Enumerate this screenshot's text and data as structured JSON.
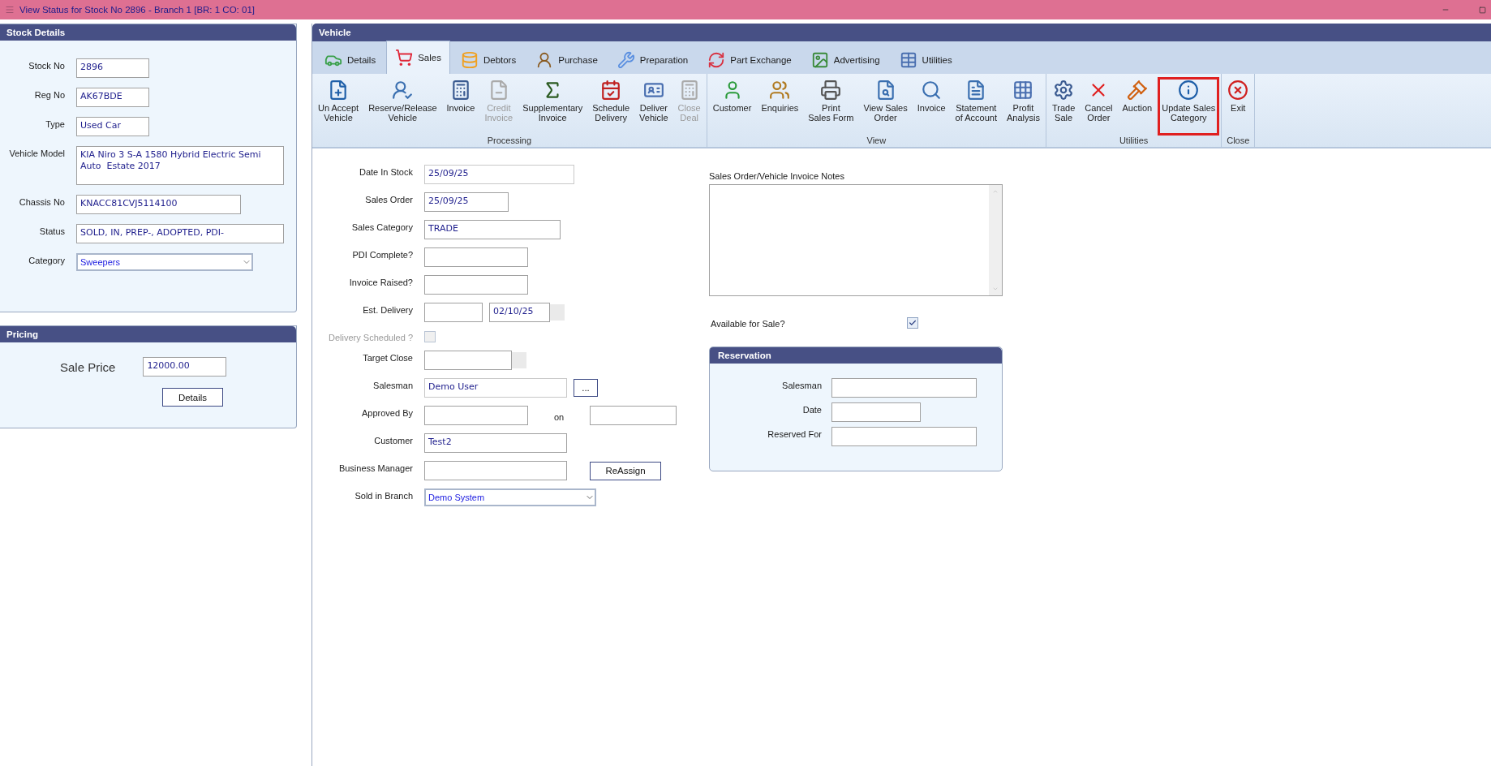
{
  "window": {
    "title": "View Status for Stock No 2896 - Branch 1 [BR: 1 CO: 01]"
  },
  "stock_details": {
    "title": "Stock Details",
    "fields": [
      {
        "kind": "text",
        "label": "Stock No",
        "value": "2896"
      },
      {
        "kind": "text",
        "label": "Reg No",
        "value": "AK67BDE"
      },
      {
        "kind": "text",
        "label": "Type",
        "value": "Used Car"
      },
      {
        "kind": "multiline",
        "label": "Vehicle Model",
        "value": "KIA Niro 3 S-A 1580 Hybrid Electric Semi Auto  Estate 2017"
      },
      {
        "kind": "text",
        "label": "Chassis No",
        "value": "KNACC81CVJ5114100"
      },
      {
        "kind": "text",
        "label": "Status",
        "value": "SOLD, IN, PREP-, ADOPTED, PDI-"
      },
      {
        "kind": "select",
        "label": "Category",
        "value": "Sweepers"
      }
    ]
  },
  "pricing": {
    "title": "Pricing",
    "label": "Sale Price",
    "value": "12000.00",
    "button": "Details"
  },
  "vehicle": {
    "title": "Vehicle",
    "tabs": [
      {
        "label": "Details",
        "selected": false
      },
      {
        "label": "Sales",
        "selected": true
      },
      {
        "label": "Debtors",
        "selected": false
      },
      {
        "label": "Purchase",
        "selected": false
      },
      {
        "label": "Preparation",
        "selected": false
      },
      {
        "label": "Part Exchange",
        "selected": false
      },
      {
        "label": "Advertising",
        "selected": false
      },
      {
        "label": "Utilities",
        "selected": false
      }
    ],
    "ribbon": [
      {
        "label": "Processing",
        "buttons": [
          {
            "label": "Un Accept\nVehicle",
            "disabled": false,
            "highlighted": false
          },
          {
            "label": "Reserve/Release\nVehicle",
            "disabled": false,
            "highlighted": false
          },
          {
            "label": "Invoice",
            "disabled": false,
            "highlighted": false
          },
          {
            "label": "Credit\nInvoice",
            "disabled": true,
            "highlighted": false
          },
          {
            "label": "Supplementary\nInvoice",
            "disabled": false,
            "highlighted": false
          },
          {
            "label": "Schedule\nDelivery",
            "disabled": false,
            "highlighted": false
          },
          {
            "label": "Deliver\nVehicle",
            "disabled": false,
            "highlighted": false
          },
          {
            "label": "Close\nDeal",
            "disabled": true,
            "highlighted": false
          }
        ]
      },
      {
        "label": "View",
        "buttons": [
          {
            "label": "Customer",
            "disabled": false,
            "highlighted": false
          },
          {
            "label": "Enquiries",
            "disabled": false,
            "highlighted": false
          },
          {
            "label": "Print\nSales Form",
            "disabled": false,
            "highlighted": false
          },
          {
            "label": "View Sales\nOrder",
            "disabled": false,
            "highlighted": false
          },
          {
            "label": "Invoice",
            "disabled": false,
            "highlighted": false
          },
          {
            "label": "Statement\nof Account",
            "disabled": false,
            "highlighted": false
          },
          {
            "label": "Profit\nAnalysis",
            "disabled": false,
            "highlighted": false
          }
        ]
      },
      {
        "label": "Utilities",
        "buttons": [
          {
            "label": "Trade\nSale",
            "disabled": false,
            "highlighted": false
          },
          {
            "label": "Cancel\nOrder",
            "disabled": false,
            "highlighted": false
          },
          {
            "label": "Auction",
            "disabled": false,
            "highlighted": false
          },
          {
            "label": "Update Sales\nCategory",
            "disabled": false,
            "highlighted": true
          }
        ]
      },
      {
        "label": "Close",
        "buttons": [
          {
            "label": "Exit",
            "disabled": false,
            "highlighted": false
          }
        ]
      }
    ]
  },
  "sales_form": [
    {
      "kind": "text",
      "label": "Date In Stock",
      "value": "25/09/25"
    },
    {
      "kind": "text",
      "label": "Sales Order",
      "value": "25/09/25"
    },
    {
      "kind": "text",
      "label": "Sales Category",
      "value": "TRADE"
    },
    {
      "kind": "text",
      "label": "PDI Complete?"
    },
    {
      "kind": "text",
      "label": "Invoice Raised?"
    },
    {
      "kind": "date_pair",
      "label": "Est. Delivery",
      "value_2": "02/10/25"
    },
    {
      "kind": "checkbox",
      "label": "Delivery Scheduled ?",
      "checked": false,
      "disabled": true
    },
    {
      "kind": "date",
      "label": "Target Close"
    },
    {
      "kind": "lookup",
      "label": "Salesman",
      "value": "Demo User",
      "button": "..."
    },
    {
      "kind": "approval",
      "label": "Approved By",
      "on_label": "on"
    },
    {
      "kind": "text",
      "label": "Customer",
      "value": "Test2"
    },
    {
      "kind": "action",
      "label": "Business Manager",
      "button": "ReAssign"
    },
    {
      "kind": "select",
      "label": "Sold in Branch",
      "value": "Demo System"
    }
  ],
  "notes": {
    "label": "Sales Order/Vehicle Invoice Notes"
  },
  "available_for_sale": {
    "label": "Available for Sale?",
    "checked": true
  },
  "reservation": {
    "title": "Reservation",
    "fields": [
      {
        "label": "Salesman"
      },
      {
        "label": "Date"
      },
      {
        "label": "Reserved For"
      }
    ]
  }
}
